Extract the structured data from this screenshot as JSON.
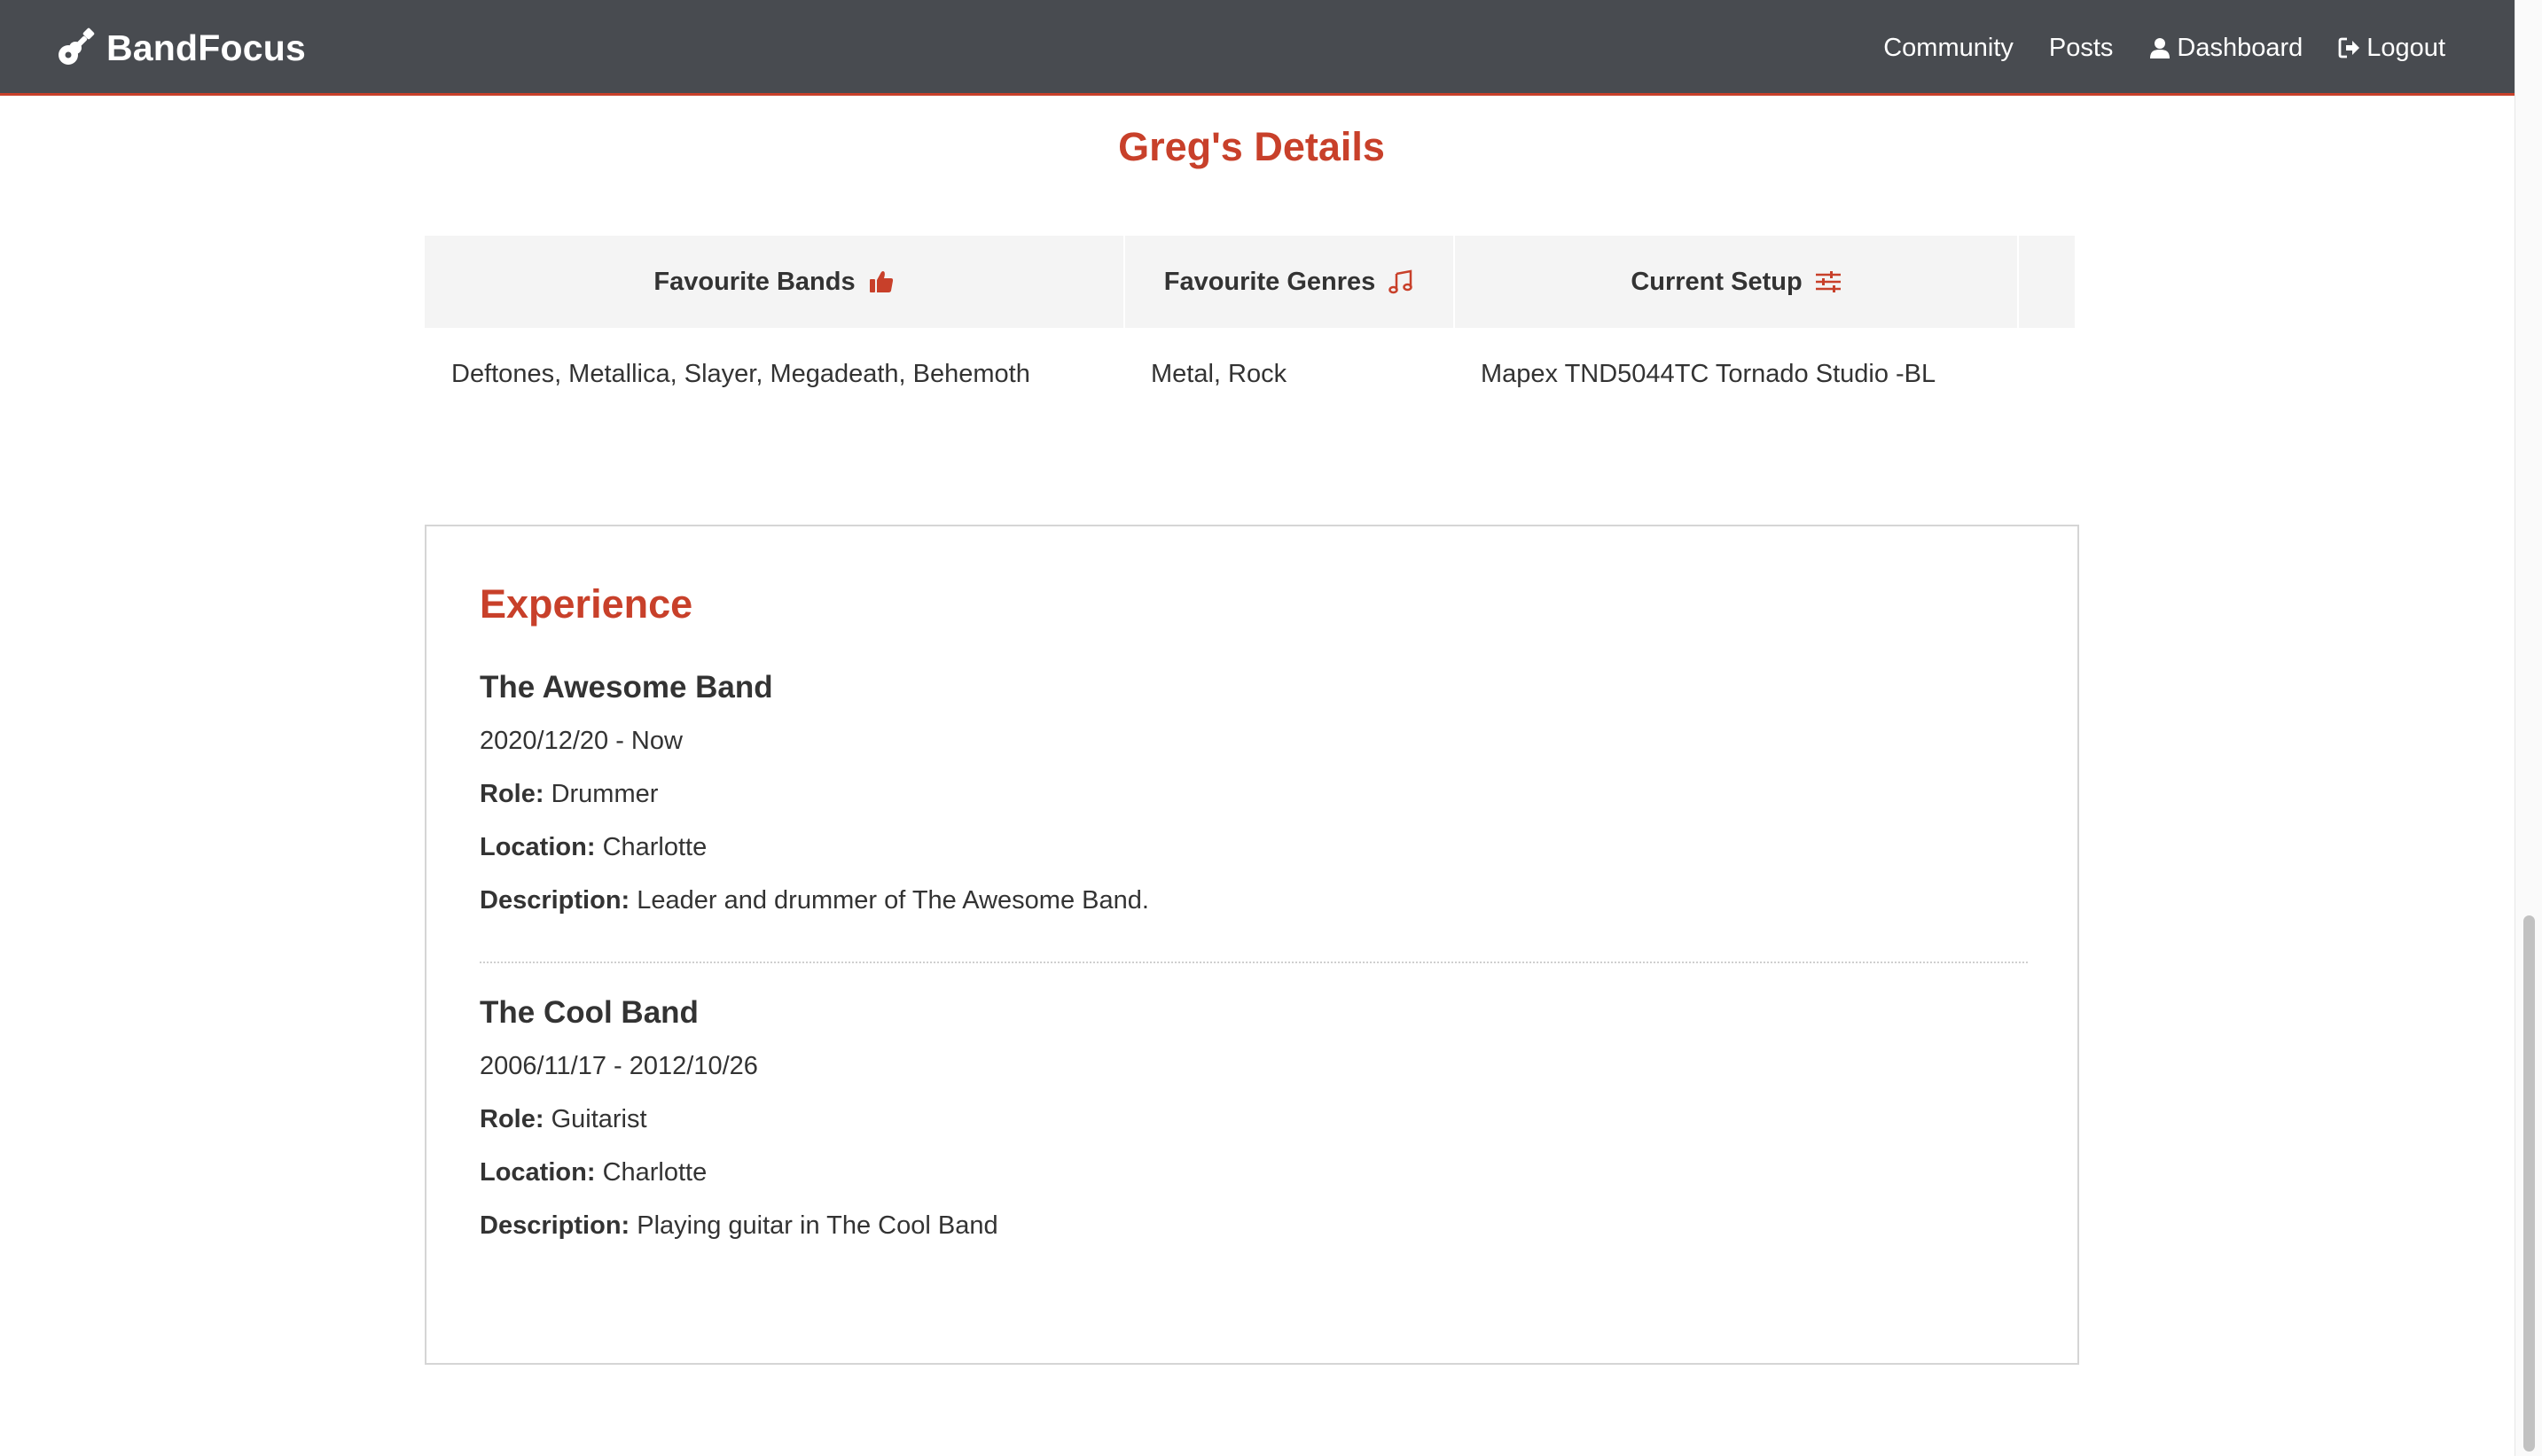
{
  "colors": {
    "navbar_bg": "#484b50",
    "accent": "#c8402a",
    "table_header_bg": "#f4f4f4",
    "text": "#333333"
  },
  "navbar": {
    "brand": "BandFocus",
    "brand_icon": "guitar-icon",
    "links": [
      {
        "label": "Community",
        "icon": null
      },
      {
        "label": "Posts",
        "icon": null
      },
      {
        "label": "Dashboard",
        "icon": "user-icon"
      },
      {
        "label": "Logout",
        "icon": "sign-out-icon"
      }
    ]
  },
  "details": {
    "title": "Greg's Details",
    "columns": [
      {
        "header": "Favourite Bands",
        "icon": "thumbs-up-icon"
      },
      {
        "header": "Favourite Genres",
        "icon": "music-note-icon"
      },
      {
        "header": "Current Setup",
        "icon": "sliders-icon"
      }
    ],
    "row": [
      "Deftones, Metallica, Slayer, Megadeath, Behemoth",
      "Metal, Rock",
      "Mapex TND5044TC Tornado Studio -BL"
    ]
  },
  "experience": {
    "title": "Experience",
    "labels": {
      "role": "Role:",
      "location": "Location:",
      "description": "Description:"
    },
    "items": [
      {
        "band": "The Awesome Band",
        "dates": "2020/12/20 - Now",
        "role": "Drummer",
        "location": "Charlotte",
        "description": "Leader and drummer of The Awesome Band."
      },
      {
        "band": "The Cool Band",
        "dates": "2006/11/17 - 2012/10/26",
        "role": "Guitarist",
        "location": "Charlotte",
        "description": "Playing guitar in The Cool Band"
      }
    ]
  }
}
